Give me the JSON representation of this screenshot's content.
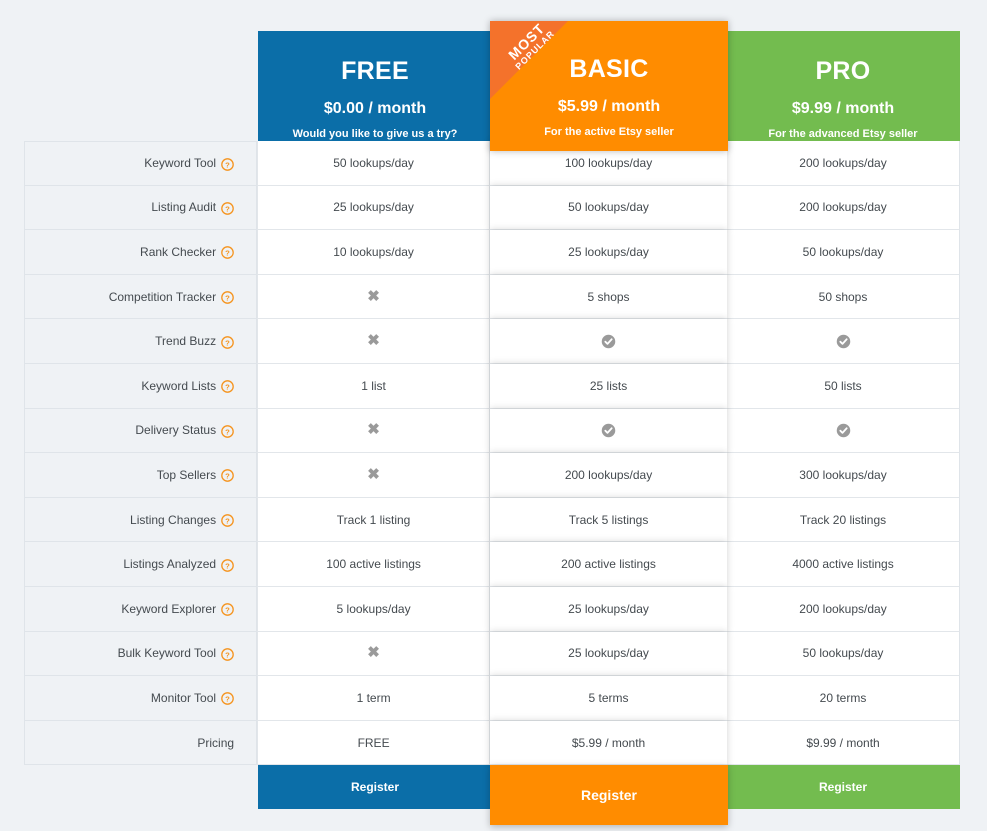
{
  "plans": [
    {
      "key": "free",
      "name": "FREE",
      "price": "$0.00 / month",
      "tagline": "Would you like to give us a try?",
      "color": "#0b6ea8",
      "cta": "Register",
      "badge": null
    },
    {
      "key": "basic",
      "name": "BASIC",
      "price": "$5.99 / month",
      "tagline": "For the active Etsy seller",
      "color": "#ff8c00",
      "cta": "Register",
      "badge": {
        "line1": "MOST",
        "line2": "POPULAR",
        "color": "#f4722b"
      }
    },
    {
      "key": "pro",
      "name": "PRO",
      "price": "$9.99 / month",
      "tagline": "For the advanced Etsy seller",
      "color": "#73bc4f",
      "cta": "Register",
      "badge": null
    }
  ],
  "features": [
    {
      "label": "Keyword Tool",
      "help": true,
      "free": "50 lookups/day",
      "basic": "100 lookups/day",
      "pro": "200 lookups/day"
    },
    {
      "label": "Listing Audit",
      "help": true,
      "free": "25 lookups/day",
      "basic": "50 lookups/day",
      "pro": "200 lookups/day"
    },
    {
      "label": "Rank Checker",
      "help": true,
      "free": "10 lookups/day",
      "basic": "25 lookups/day",
      "pro": "50 lookups/day"
    },
    {
      "label": "Competition Tracker",
      "help": true,
      "free": "cross-icon",
      "basic": "5 shops",
      "pro": "50 shops"
    },
    {
      "label": "Trend Buzz",
      "help": true,
      "free": "cross-icon",
      "basic": "check-icon",
      "pro": "check-icon"
    },
    {
      "label": "Keyword Lists",
      "help": true,
      "free": "1 list",
      "basic": "25 lists",
      "pro": "50 lists"
    },
    {
      "label": "Delivery Status",
      "help": true,
      "free": "cross-icon",
      "basic": "check-icon",
      "pro": "check-icon"
    },
    {
      "label": "Top Sellers",
      "help": true,
      "free": "cross-icon",
      "basic": "200 lookups/day",
      "pro": "300 lookups/day"
    },
    {
      "label": "Listing Changes",
      "help": true,
      "free": "Track 1 listing",
      "basic": "Track 5 listings",
      "pro": "Track 20 listings"
    },
    {
      "label": "Listings Analyzed",
      "help": true,
      "free": "100 active listings",
      "basic": "200 active listings",
      "pro": "4000 active listings"
    },
    {
      "label": "Keyword Explorer",
      "help": true,
      "free": "5 lookups/day",
      "basic": "25 lookups/day",
      "pro": "200 lookups/day"
    },
    {
      "label": "Bulk Keyword Tool",
      "help": true,
      "free": "cross-icon",
      "basic": "25 lookups/day",
      "pro": "50 lookups/day"
    },
    {
      "label": "Monitor Tool",
      "help": true,
      "free": "1 term",
      "basic": "5 terms",
      "pro": "20 terms"
    },
    {
      "label": "Pricing",
      "help": false,
      "free": "FREE",
      "basic": "$5.99 / month",
      "pro": "$9.99 / month"
    }
  ],
  "icons": {
    "help": "help-circle-icon",
    "cross": "cross-icon",
    "check": "check-circle-icon",
    "cross_glyph": "✖",
    "help_color": "#f5941f",
    "mark_color": "#9a9a9a"
  },
  "theme": {
    "page_background": "#eff2f5",
    "feature_cell_background": "#eff2f5",
    "value_cell_background": "#ffffff",
    "grid_line": "#e2e6ea",
    "text_color": "#444a4f"
  }
}
